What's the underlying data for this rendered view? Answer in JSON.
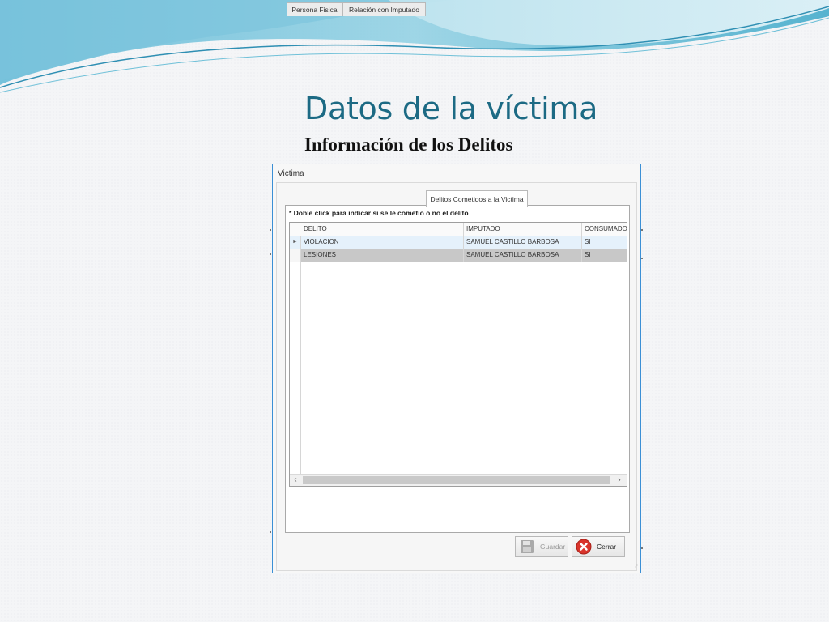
{
  "slide": {
    "title": "Datos de la víctima",
    "subtitle": "Información de los Delitos"
  },
  "window": {
    "title": "Victima",
    "tabs": [
      {
        "label": "Persona Fisica",
        "active": false
      },
      {
        "label": "Relación con Imputado",
        "active": false
      },
      {
        "label": "Delitos Cometidos a la Victima",
        "active": true
      }
    ],
    "hint": "* Doble click para indicar si se le cometio o no el delito",
    "grid": {
      "columns": [
        "DELITO",
        "IMPUTADO",
        "CONSUMADO"
      ],
      "rows": [
        {
          "delito": "VIOLACION",
          "imputado": "SAMUEL CASTILLO BARBOSA",
          "consumado": "SI",
          "current": true
        },
        {
          "delito": "LESIONES",
          "imputado": "SAMUEL CASTILLO BARBOSA",
          "consumado": "SI",
          "current": false
        }
      ],
      "row_indicator_icon": "arrow-right-icon",
      "scroll_left_icon": "chevron-left-icon",
      "scroll_right_icon": "chevron-right-icon"
    },
    "buttons": {
      "save": {
        "label": "Guardar",
        "icon": "floppy-disk-icon",
        "enabled": false
      },
      "close": {
        "label": "Cerrar",
        "icon": "close-icon",
        "enabled": true
      }
    }
  },
  "colors": {
    "title_color": "#1c6a84",
    "window_border": "#3b8fd5",
    "selected_row": "#e5f1fb",
    "alt_row": "#c8c8c8",
    "close_icon_red": "#d9342b",
    "wave_teal": "#3aa7c8"
  }
}
